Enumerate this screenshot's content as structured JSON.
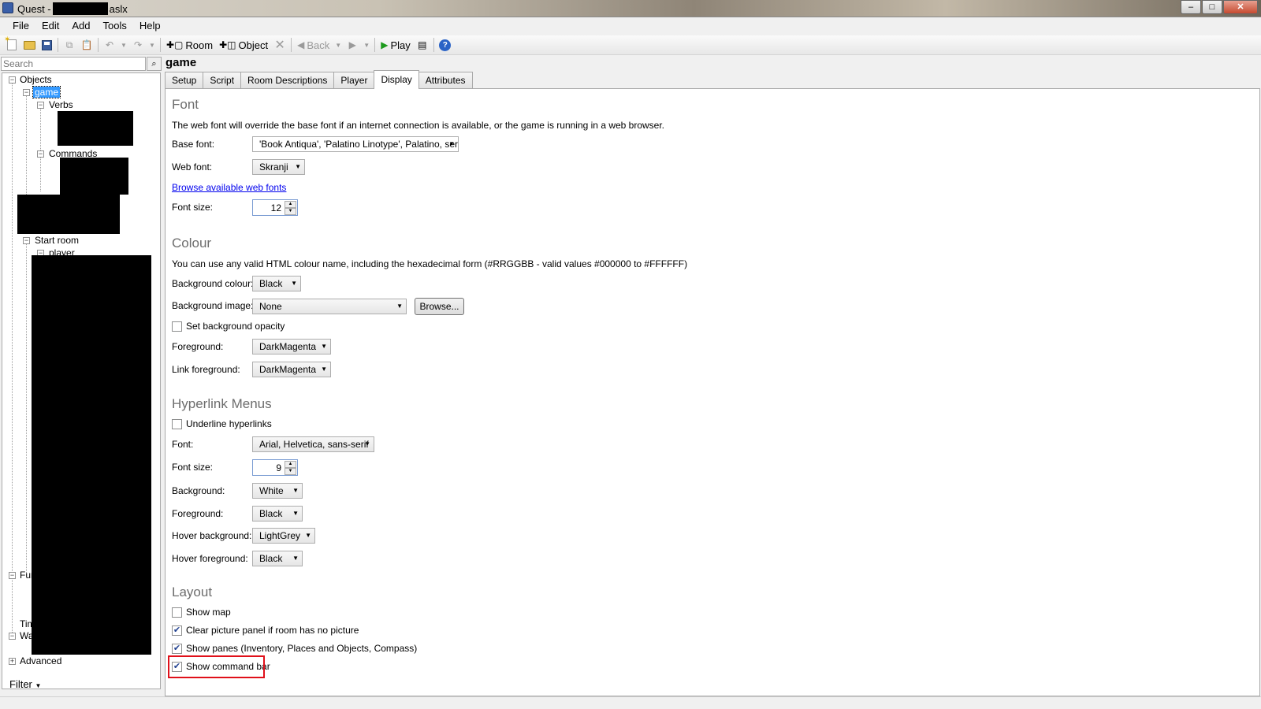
{
  "window": {
    "title_prefix": "Quest -",
    "title_suffix": "aslx",
    "minimize": "–",
    "maximize": "□",
    "close": "✕"
  },
  "menu": [
    "File",
    "Edit",
    "Add",
    "Tools",
    "Help"
  ],
  "toolbar": {
    "room_label": "Room",
    "object_label": "Object",
    "back_label": "Back",
    "play_label": "Play"
  },
  "search": {
    "placeholder": "Search"
  },
  "tree": {
    "objects": "Objects",
    "game": "game",
    "verbs": "Verbs",
    "commands": "Commands",
    "start_room": "Start room",
    "player": "player",
    "functions_partial": "Fur",
    "timers_partial": "Tim",
    "walkthrough_partial": "Wa",
    "advanced": "Advanced"
  },
  "filter_label": "Filter",
  "page_title": "game",
  "tabs": [
    "Setup",
    "Script",
    "Room Descriptions",
    "Player",
    "Display",
    "Attributes"
  ],
  "active_tab": "Display",
  "font_section": {
    "heading": "Font",
    "description": "The web font will override the base font if an internet connection is available, or the game is running in a web browser.",
    "base_font_label": "Base font:",
    "base_font_value": "'Book Antiqua', 'Palatino Linotype', Palatino, serif",
    "web_font_label": "Web font:",
    "web_font_value": "Skranji",
    "browse_link": "Browse available web fonts",
    "font_size_label": "Font size:",
    "font_size_value": "12"
  },
  "colour_section": {
    "heading": "Colour",
    "description": "You can use any valid HTML colour name, including the hexadecimal form (#RRGGBB - valid values #000000 to #FFFFFF)",
    "bg_colour_label": "Background colour:",
    "bg_colour_value": "Black",
    "bg_image_label": "Background image:",
    "bg_image_value": "None",
    "browse_button": "Browse...",
    "opacity_label": "Set background opacity",
    "opacity_checked": false,
    "foreground_label": "Foreground:",
    "foreground_value": "DarkMagenta",
    "link_fg_label": "Link foreground:",
    "link_fg_value": "DarkMagenta"
  },
  "hyperlink_section": {
    "heading": "Hyperlink Menus",
    "underline_label": "Underline hyperlinks",
    "underline_checked": false,
    "font_label": "Font:",
    "font_value": "Arial, Helvetica, sans-serif",
    "font_size_label": "Font size:",
    "font_size_value": "9",
    "background_label": "Background:",
    "background_value": "White",
    "foreground_label": "Foreground:",
    "foreground_value": "Black",
    "hover_bg_label": "Hover background:",
    "hover_bg_value": "LightGrey",
    "hover_fg_label": "Hover foreground:",
    "hover_fg_value": "Black"
  },
  "layout_section": {
    "heading": "Layout",
    "show_map_label": "Show map",
    "show_map_checked": false,
    "clear_picture_label": "Clear picture panel if room has no picture",
    "clear_picture_checked": true,
    "show_panes_label": "Show panes (Inventory, Places and Objects, Compass)",
    "show_panes_checked": true,
    "show_command_bar_label": "Show command bar",
    "show_command_bar_checked": true
  },
  "colors": {
    "highlight": "#e0101a",
    "selection": "#3399ff",
    "section_heading": "#6d6d6d",
    "link": "#0000ee"
  }
}
